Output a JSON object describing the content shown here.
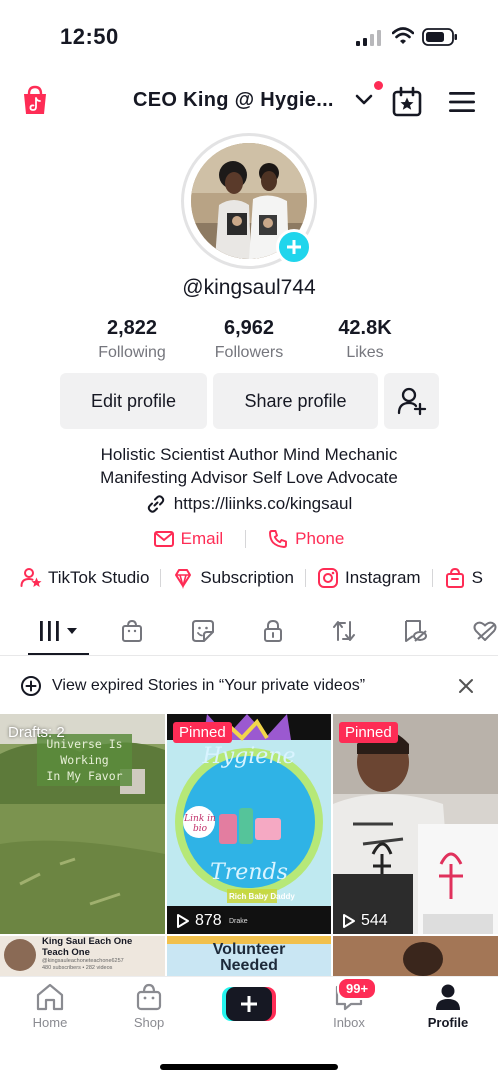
{
  "status_bar": {
    "time": "12:50"
  },
  "header": {
    "title": "CEO  King  @  Hygie...",
    "icons": [
      "tiktok-shop-icon",
      "chevron-down-icon",
      "calendar-star-icon",
      "menu-icon"
    ],
    "notification_dot_color": "#fe2c55"
  },
  "profile": {
    "username": "@kingsaul744",
    "stats": [
      {
        "value": "2,822",
        "label": "Following"
      },
      {
        "value": "6,962",
        "label": "Followers"
      },
      {
        "value": "42.8K",
        "label": "Likes"
      }
    ],
    "buttons": {
      "edit": "Edit profile",
      "share": "Share profile"
    },
    "bio_line1": "Holistic Scientist Author Mind Mechanic",
    "bio_line2": "Manifesting Advisor Self Love Advocate",
    "link": "https://liinks.co/kingsaul",
    "email_label": "Email",
    "phone_label": "Phone"
  },
  "quick_links": [
    {
      "label": "TikTok Studio",
      "icon": "studio-icon"
    },
    {
      "label": "Subscription",
      "icon": "subscription-icon"
    },
    {
      "label": "Instagram",
      "icon": "instagram-icon"
    },
    {
      "label": "S",
      "icon": "shop-bag-icon"
    }
  ],
  "tabs": [
    "videos-grid-icon",
    "shop-icon",
    "sticker-icon",
    "lock-icon",
    "repost-icon",
    "favorites-icon",
    "liked-icon"
  ],
  "banner": {
    "text": "View expired Stories in “Your private videos”"
  },
  "grid": {
    "drafts_label": "Drafts: 2",
    "draft_overlay_line1": "Universe Is",
    "draft_overlay_line2": "Working",
    "draft_overlay_line3": "In My Favor",
    "pinned_label": "Pinned",
    "video2_views": "878",
    "video2_caption1": "Link in bio",
    "video2_caption2": "Rich Baby Daddy",
    "video2_caption3": "Drake",
    "video3_views": "544",
    "video4_title1": "King Saul Each One",
    "video4_title2": "Teach One",
    "video4_sub1": "@kingsauleachoneteachone6257",
    "video4_sub2": "480 subscribers • 282 videos",
    "video5_text1": "Volunteer",
    "video5_text2": "Needed"
  },
  "bottom_nav": {
    "home": "Home",
    "shop": "Shop",
    "inbox": "Inbox",
    "inbox_badge": "99+",
    "profile": "Profile"
  },
  "colors": {
    "accent": "#fe2c55",
    "cyan": "#20d5ec",
    "text": "#161823",
    "muted": "#75767d"
  }
}
